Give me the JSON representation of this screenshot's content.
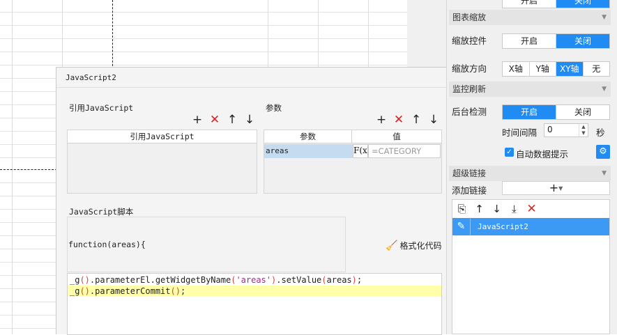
{
  "panel": {
    "top_partial": {
      "on": "开启",
      "off": "关闭"
    },
    "chart_zoom": {
      "header": "图表缩放",
      "zoom_control_label": "缩放控件",
      "zoom_control": {
        "on": "开启",
        "off": "关闭",
        "active": "off"
      },
      "zoom_direction_label": "缩放方向",
      "zoom_direction": {
        "x": "X轴",
        "y": "Y轴",
        "xy": "XY轴",
        "none": "无",
        "active": "xy"
      }
    },
    "monitor_refresh": {
      "header": "监控刷新",
      "bg_check_label": "后台检测",
      "bg_check": {
        "on": "开启",
        "off": "关闭",
        "active": "on"
      },
      "interval_label": "时间间隔",
      "interval_value": "0",
      "interval_unit": "秒",
      "auto_hint_label": "自动数据提示",
      "auto_hint_checked": true
    },
    "hyperlink": {
      "header": "超级链接",
      "add_link_label": "添加链接",
      "items": [
        {
          "label": "JavaScript2"
        }
      ]
    }
  },
  "dialog": {
    "title": "JavaScript2",
    "ref_js": {
      "title": "引用JavaScript",
      "column": "引用JavaScript"
    },
    "params": {
      "title": "参数",
      "columns": {
        "name": "参数",
        "value": "值"
      },
      "rows": [
        {
          "name": "areas",
          "formula_icon": "F(x)",
          "value": "=CATEGORY"
        }
      ]
    },
    "script": {
      "title": "JavaScript脚本",
      "signature": "function(areas){",
      "format_label": "格式化代码"
    }
  },
  "colors": {
    "accent": "#1f8bf3",
    "selected_row": "#3c9af5",
    "delete_red": "#e02020",
    "code_highlight": "#ffffaa"
  }
}
